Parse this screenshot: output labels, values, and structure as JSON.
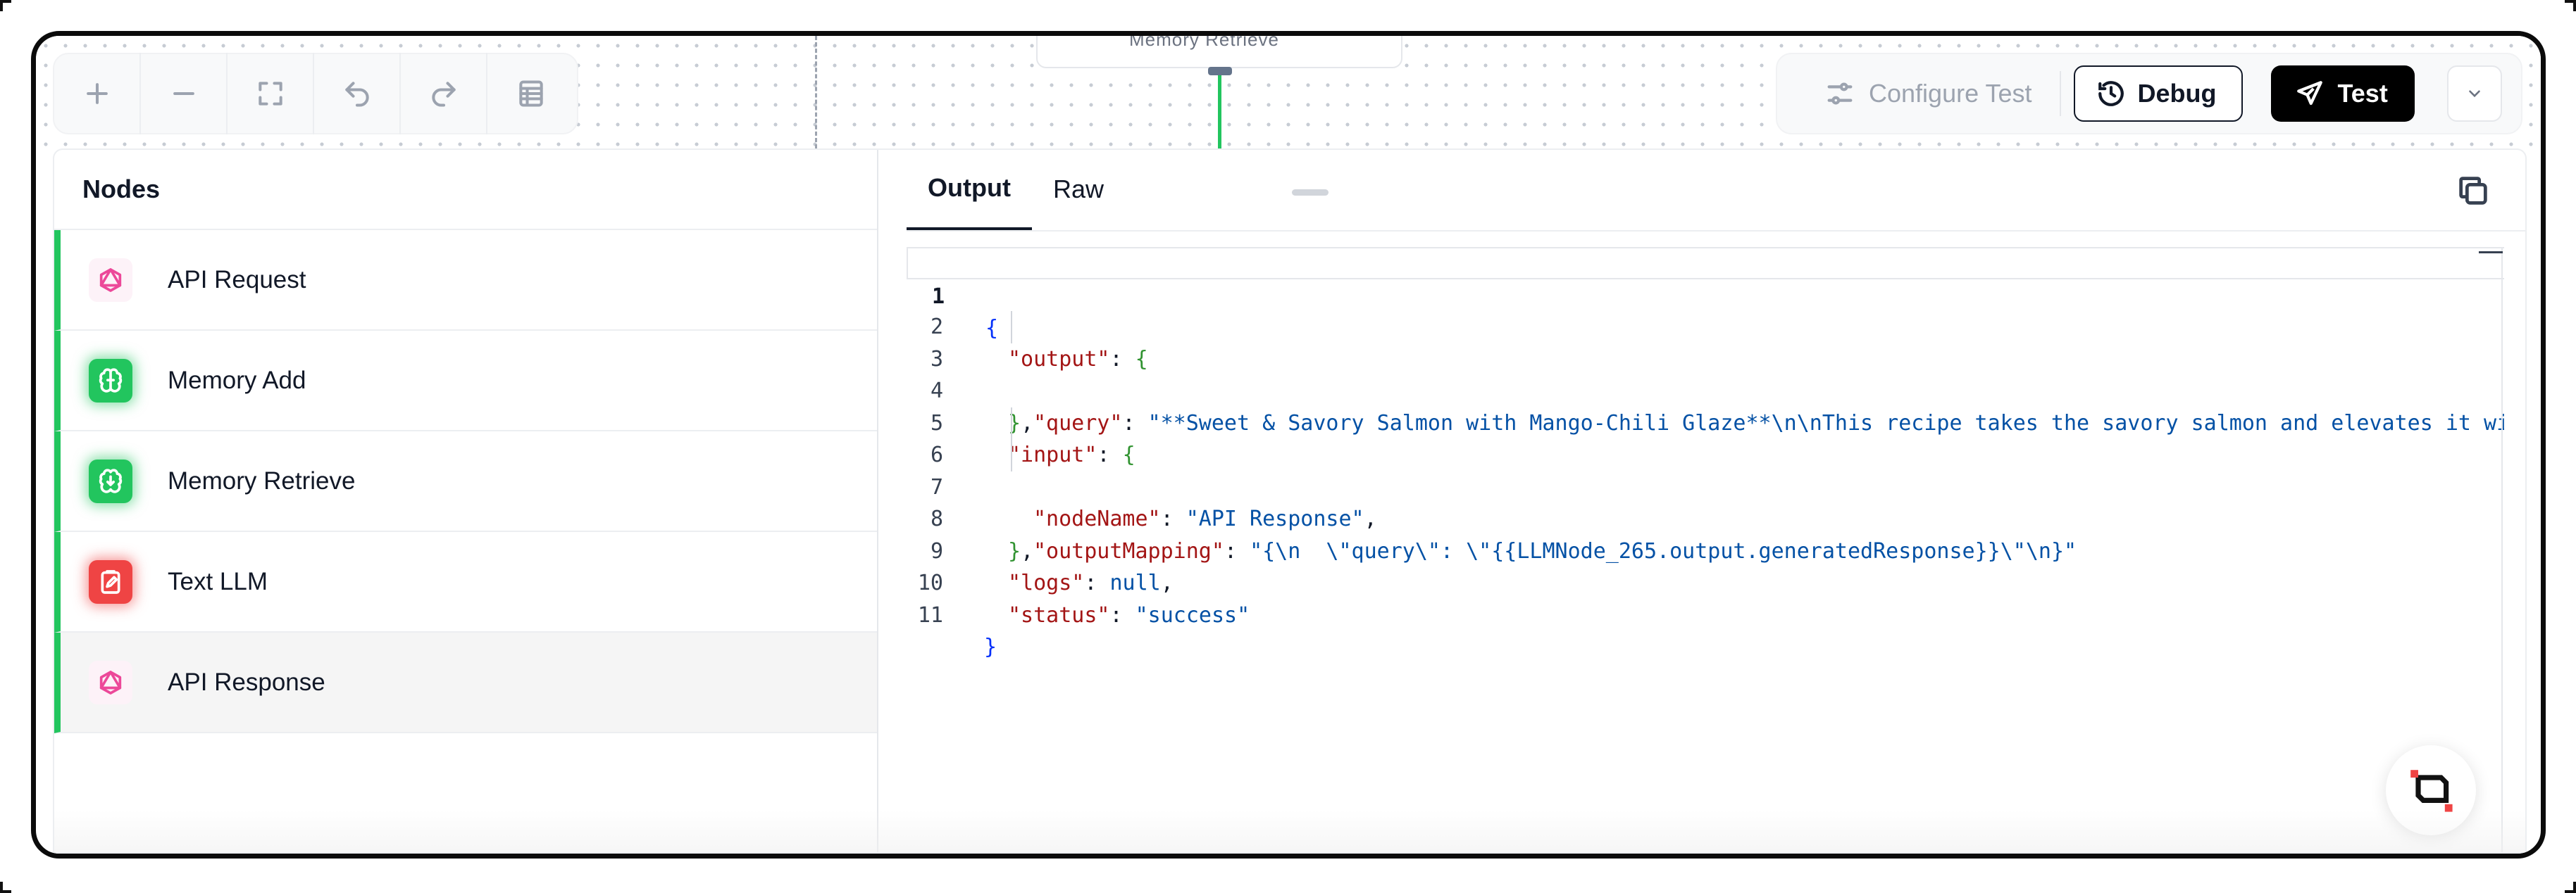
{
  "canvas": {
    "node_stub_label": "Memory Retrieve"
  },
  "zoom_toolbar": {
    "icons": [
      "plus-icon",
      "minus-icon",
      "fit-view-icon",
      "undo-icon",
      "redo-icon",
      "list-icon"
    ]
  },
  "top_actions": {
    "configure_label": "Configure Test",
    "debug_label": "Debug",
    "test_label": "Test"
  },
  "nodes_panel": {
    "title": "Nodes",
    "items": [
      {
        "label": "API Request",
        "icon": "graphql-icon",
        "color": "#ec4899"
      },
      {
        "label": "Memory Add",
        "icon": "brain-plus-icon",
        "color": "#22c55e"
      },
      {
        "label": "Memory Retrieve",
        "icon": "brain-download-icon",
        "color": "#22c55e"
      },
      {
        "label": "Text LLM",
        "icon": "clipboard-edit-icon",
        "color": "#ef4444"
      },
      {
        "label": "API Response",
        "icon": "graphql-icon",
        "color": "#ec4899"
      }
    ],
    "selected": "API Response",
    "status_color": "#22c55e"
  },
  "output_panel": {
    "tabs": [
      "Output",
      "Raw"
    ],
    "active_tab": "Output",
    "line_numbers": [
      "1",
      "2",
      "3",
      "4",
      "5",
      "6",
      "7",
      "8",
      "9",
      "10",
      "11"
    ],
    "json": {
      "output_key": "\"output\"",
      "query_key": "\"query\"",
      "query_value": "\"**Sweet & Savory Salmon with Mango-Chili Glaze**\\n\\nThis recipe takes the savory salmon and elevates it wi",
      "input_key": "\"input\"",
      "nodeName_key": "\"nodeName\"",
      "nodeName_value": "\"API Response\"",
      "outputMapping_key": "\"outputMapping\"",
      "outputMapping_value": "\"{\\n  \\\"query\\\": \\\"{{LLMNode_265.output.generatedResponse}}\\\"\\n}\"",
      "logs_key": "\"logs\"",
      "logs_value": "null",
      "status_key": "\"status\"",
      "status_value": "\"success\""
    }
  }
}
